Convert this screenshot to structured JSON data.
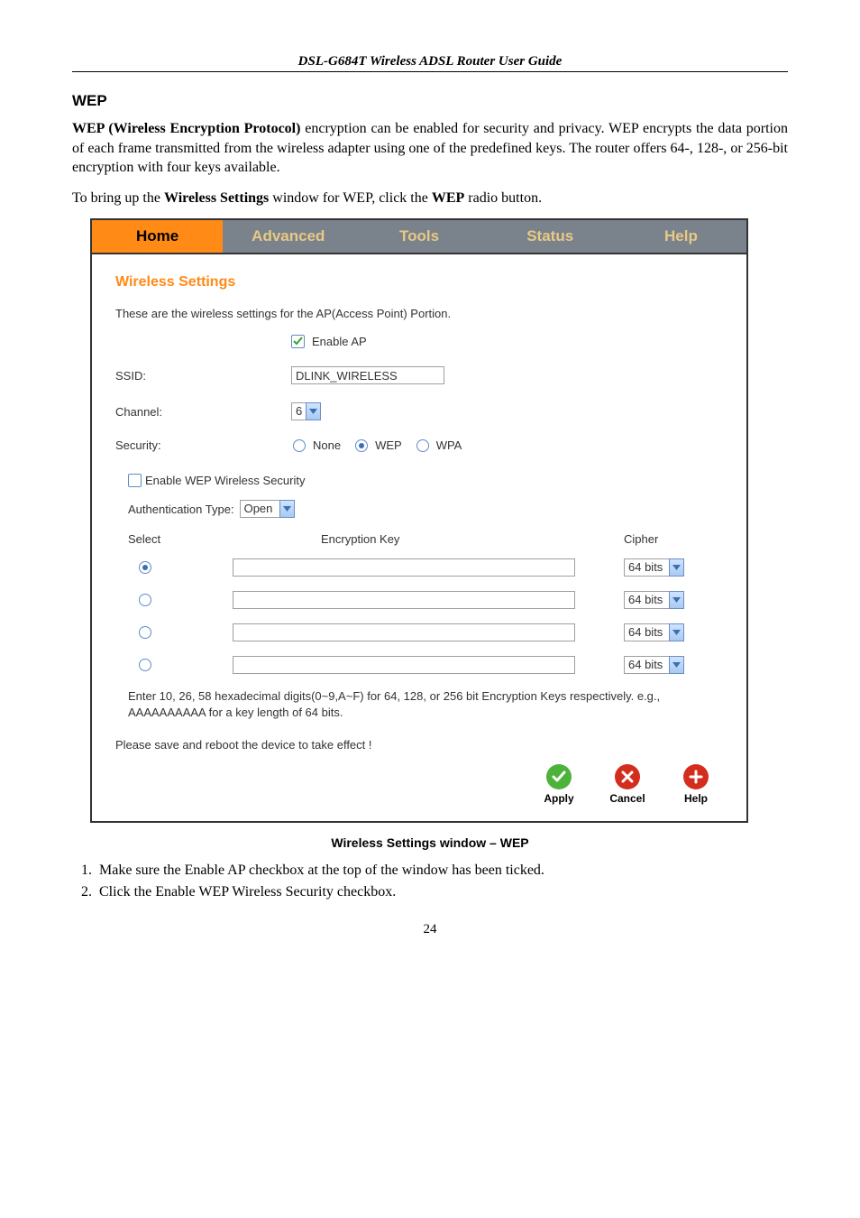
{
  "doc": {
    "header": "DSL-G684T Wireless ADSL Router User Guide",
    "section_heading": "WEP",
    "p1_a": "WEP (Wireless Encryption Protocol)",
    "p1_b": " encryption can be enabled for security and privacy. WEP encrypts the data portion of each frame transmitted from the wireless adapter using one of the predefined keys. The router offers 64-, 128-, or 256-bit encryption with four keys available.",
    "p2_a": "To bring up the ",
    "p2_b": "Wireless Settings",
    "p2_c": " window for WEP, click the ",
    "p2_d": "WEP",
    "p2_e": " radio button.",
    "caption": "Wireless Settings window – WEP",
    "step1": "Make sure the Enable AP checkbox at the top of the window has been ticked.",
    "step2": "Click the Enable WEP Wireless Security checkbox.",
    "page_no": "24"
  },
  "shot": {
    "tabs": {
      "home": "Home",
      "advanced": "Advanced",
      "tools": "Tools",
      "status": "Status",
      "help": "Help"
    },
    "title": "Wireless Settings",
    "desc": "These are the wireless settings for the AP(Access Point) Portion.",
    "enable_ap": "Enable AP",
    "ssid_label": "SSID:",
    "ssid_value": "DLINK_WIRELESS",
    "channel_label": "Channel:",
    "channel_value": "6",
    "security_label": "Security:",
    "sec_none": "None",
    "sec_wep": "WEP",
    "sec_wpa": "WPA",
    "enable_wep_sec": "Enable WEP Wireless Security",
    "auth_label": "Authentication Type:",
    "auth_value": "Open",
    "head_select": "Select",
    "head_enckey": "Encryption Key",
    "head_cipher": "Cipher",
    "cipher_value": "64 bits",
    "note_hex": "Enter 10, 26, 58 hexadecimal digits(0~9,A~F) for 64, 128, or 256 bit Encryption Keys respectively. e.g., AAAAAAAAAA for a key length of 64 bits.",
    "note_reboot": "Please save and reboot the device to take effect !",
    "btn_apply": "Apply",
    "btn_cancel": "Cancel",
    "btn_help": "Help"
  }
}
